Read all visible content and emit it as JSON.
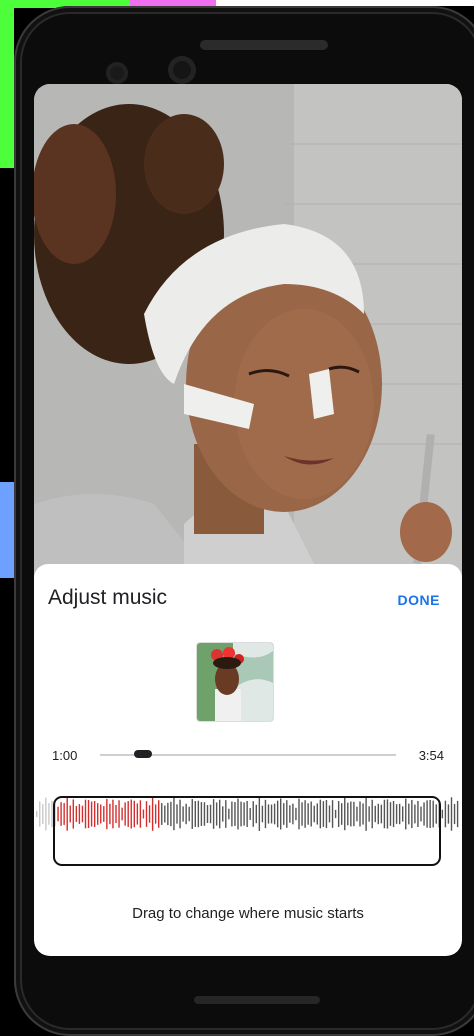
{
  "sheet": {
    "title": "Adjust music",
    "done_label": "DONE",
    "hint": "Drag to change where music starts"
  },
  "player": {
    "start_time": "1:00",
    "end_time": "3:54",
    "position_fraction": 0.14,
    "played_fraction": 0.29
  },
  "colors": {
    "accent": "#1a73e8",
    "waveform_played": "#d32f2f",
    "waveform_unplayed": "#555555"
  },
  "icons": {
    "album_art": "album-cover-image"
  }
}
